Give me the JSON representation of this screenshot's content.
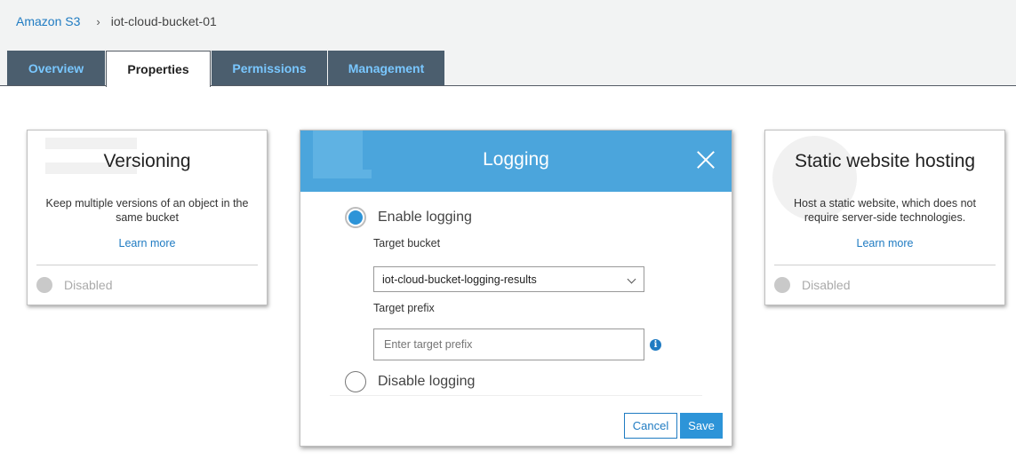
{
  "breadcrumb": {
    "root": "Amazon S3",
    "separator": "›",
    "current": "iot-cloud-bucket-01"
  },
  "tabs": [
    {
      "label": "Overview",
      "active": false
    },
    {
      "label": "Properties",
      "active": true
    },
    {
      "label": "Permissions",
      "active": false
    },
    {
      "label": "Management",
      "active": false
    }
  ],
  "versioning": {
    "title": "Versioning",
    "description": "Keep multiple versions of an object in the same bucket",
    "learn_more": "Learn more",
    "status": "Disabled"
  },
  "logging": {
    "title": "Logging",
    "enable_label": "Enable logging",
    "enable_selected": true,
    "target_bucket_label": "Target bucket",
    "target_bucket_value": "iot-cloud-bucket-logging-results",
    "target_prefix_label": "Target prefix",
    "target_prefix_placeholder": "Enter target prefix",
    "info_symbol": "i",
    "disable_label": "Disable logging",
    "cancel_label": "Cancel",
    "save_label": "Save"
  },
  "website": {
    "title": "Static website hosting",
    "description": "Host a static website, which does not require server-side technologies.",
    "learn_more": "Learn more",
    "status": "Disabled"
  },
  "colors": {
    "accent": "#2d94d8",
    "header": "#4ba5dc",
    "tab_bg": "#4b5e6e",
    "tab_text": "#79c7ff",
    "link": "#1f7bc2"
  }
}
